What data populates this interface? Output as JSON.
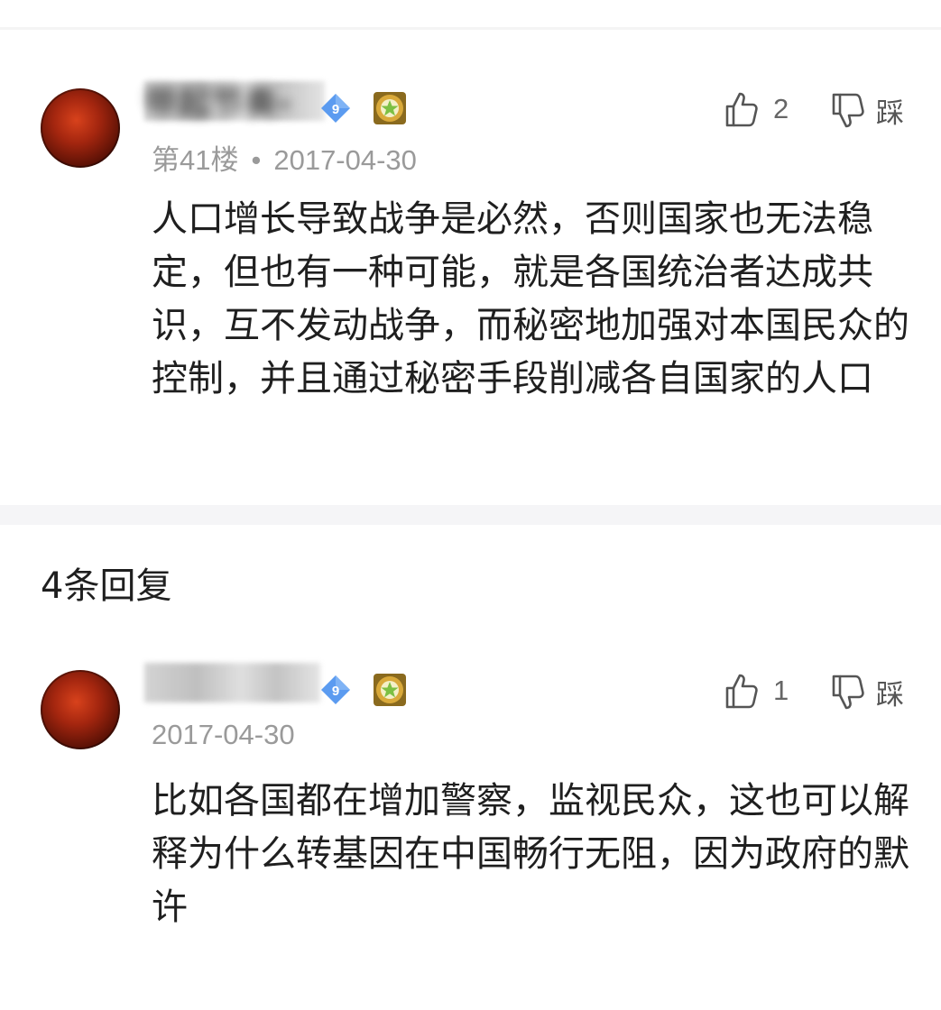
{
  "main_post": {
    "username": "带起节奏-",
    "level": "9",
    "floor": "第41楼",
    "separator": "•",
    "date": "2017-04-30",
    "likes": "2",
    "dislike_label": "踩",
    "content": "人口增长导致战争是必然，否则国家也无法稳定，但也有一种可能，就是各国统治者达成共识，互不发动战争，而秘密地加强对本国民众的控制，并且通过秘密手段削减各自国家的人口",
    "level_icon": "diamond-level-icon",
    "medal_icon": "medal-badge-icon"
  },
  "replies_header": "4条回复",
  "reply": {
    "level": "9",
    "date": "2017-04-30",
    "likes": "1",
    "dislike_label": "踩",
    "content": "比如各国都在增加警察，监视民众，这也可以解释为什么转基因在中国畅行无阻，因为政府的默许"
  },
  "colors": {
    "meta_gray": "#9a9a9a",
    "badge_blue": "#5b9bf0",
    "medal_gold": "#c99a2e",
    "divider": "#f5f5f7"
  }
}
